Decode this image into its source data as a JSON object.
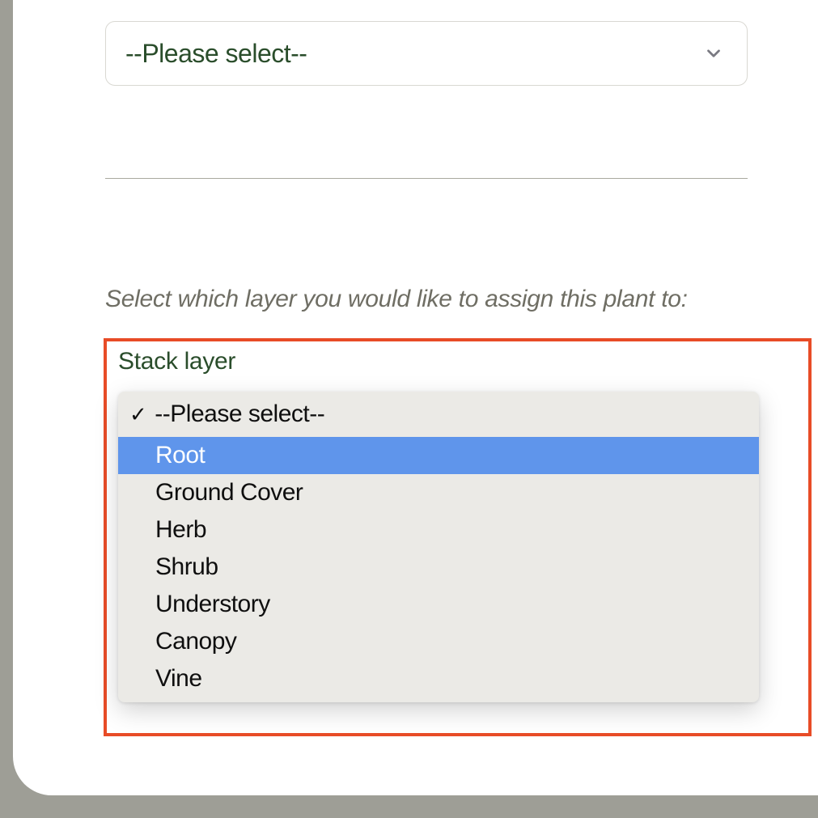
{
  "top_select": {
    "placeholder": "--Please select--"
  },
  "instruction_text": "Select which layer you would like to assign this plant to:",
  "stack_layer": {
    "label": "Stack layer",
    "selected_index": 0,
    "highlighted_index": 1,
    "options": [
      "--Please select--",
      "Root",
      "Ground Cover",
      "Herb",
      "Shrub",
      "Understory",
      "Canopy",
      "Vine"
    ]
  }
}
